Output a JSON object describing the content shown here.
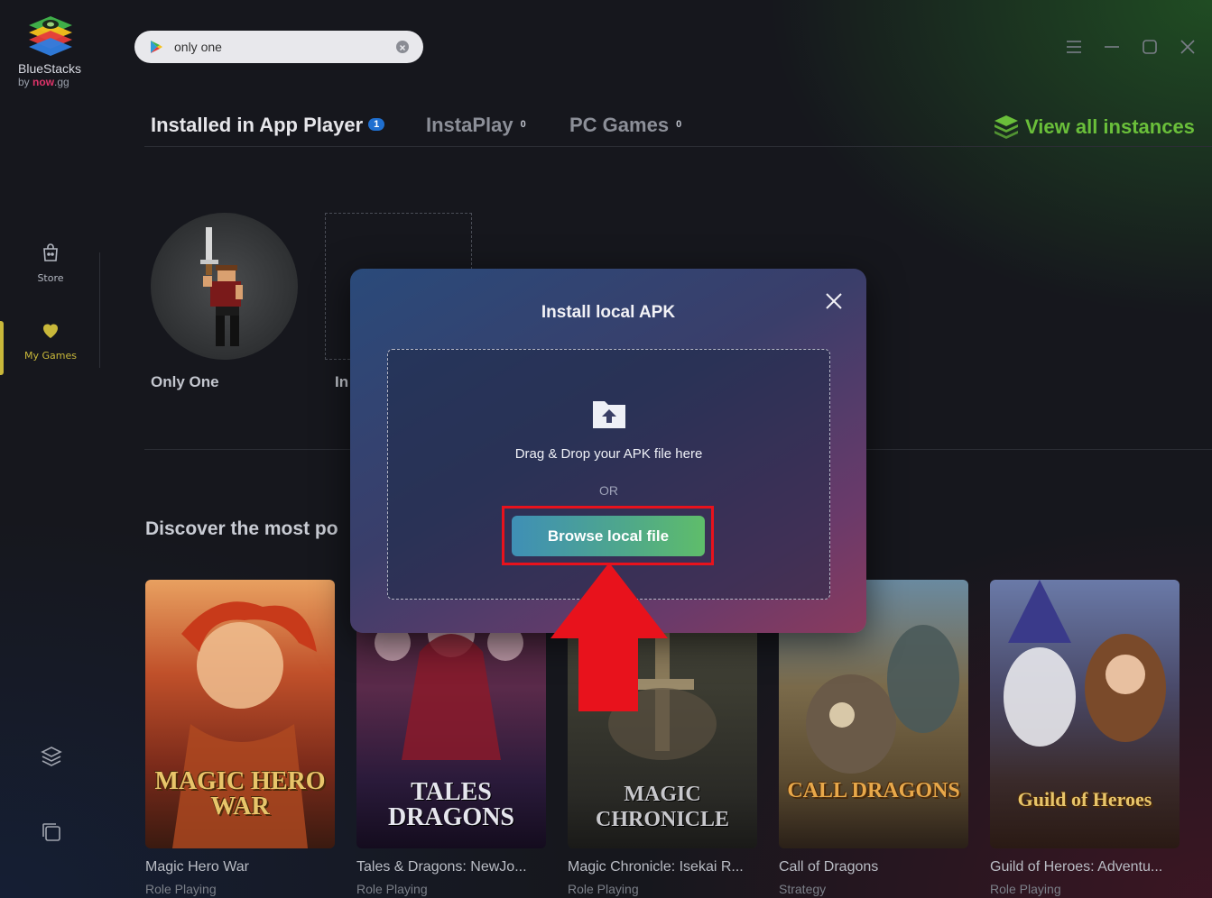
{
  "app": {
    "logo_name": "BlueStacks",
    "logo_by": "by",
    "logo_brand": "now",
    "logo_brand_suffix": ".gg"
  },
  "search": {
    "value": "only one"
  },
  "sidebar": {
    "items": [
      {
        "label": "Store",
        "icon": "store-icon"
      },
      {
        "label": "My Games",
        "icon": "heart-icon",
        "active": true
      }
    ],
    "bottom_icons": [
      "layers-icon",
      "multi-window-icon"
    ]
  },
  "tabs": [
    {
      "label": "Installed in App Player",
      "count": "1",
      "active": true
    },
    {
      "label": "InstaPlay",
      "count": "0"
    },
    {
      "label": "PC Games",
      "count": "0"
    }
  ],
  "view_all": "View all instances",
  "installed_games": [
    {
      "name": "Only One"
    }
  ],
  "install_tile_label": "In",
  "discover_heading": "Discover the most po",
  "cards": [
    {
      "name": "Magic Hero War",
      "genre": "Role Playing",
      "art_title": "MAGIC HERO WAR"
    },
    {
      "name": "Tales & Dragons: NewJo...",
      "genre": "Role Playing",
      "art_title": "TALES DRAGONS"
    },
    {
      "name": "Magic Chronicle: Isekai R...",
      "genre": "Role Playing",
      "art_title": "MAGIC CHRONICLE"
    },
    {
      "name": "Call of Dragons",
      "genre": "Strategy",
      "art_title": "CALL DRAGONS"
    },
    {
      "name": "Guild of Heroes: Adventu...",
      "genre": "Role Playing",
      "art_title": "Guild of Heroes"
    }
  ],
  "modal": {
    "title": "Install local APK",
    "drag_text": "Drag & Drop your APK file here",
    "or_text": "OR",
    "browse_label": "Browse local file"
  },
  "colors": {
    "accent_green": "#6abf3a",
    "badge_blue": "#1f6fd0",
    "highlight_red": "#e8121c",
    "active_nav": "#c9b83a"
  }
}
